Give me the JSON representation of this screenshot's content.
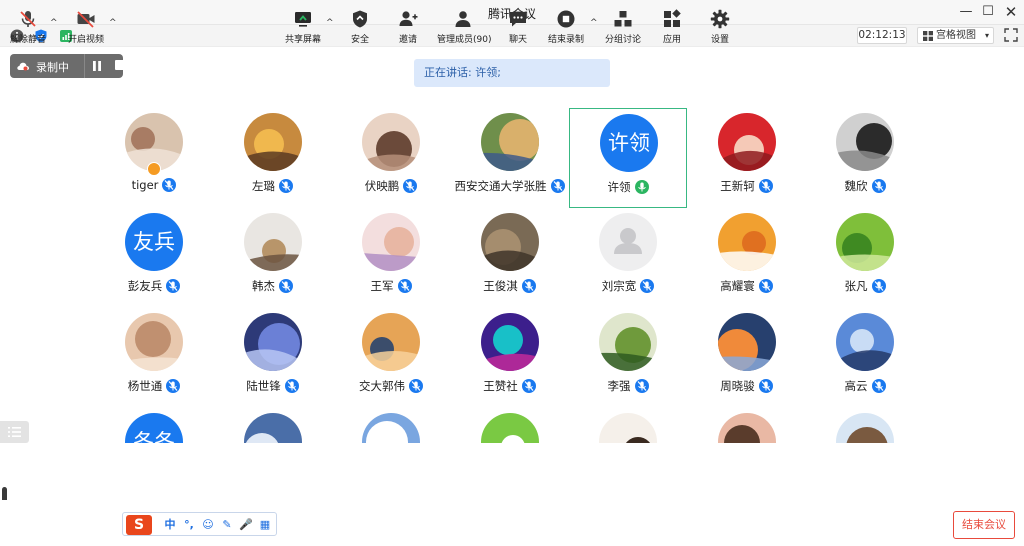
{
  "window": {
    "title": "腾讯会议",
    "controls": {
      "minimize": "—",
      "maximize": "☐",
      "close": "✕"
    }
  },
  "infobar": {
    "icons": [
      "info-icon",
      "shield-icon",
      "signal-icon"
    ],
    "timer": "02:12:13",
    "view_mode": "宫格视图",
    "view_caret": "▾"
  },
  "recording": {
    "label": "录制中",
    "icon": "cloud-record-icon"
  },
  "speaker": {
    "text": "正在讲话: 许领;"
  },
  "participants": [
    {
      "name": "tiger",
      "avatar": "photo",
      "host": true,
      "mic": "muted"
    },
    {
      "name": "左璐",
      "avatar": "photo",
      "mic": "muted"
    },
    {
      "name": "伏映鹏",
      "avatar": "photo",
      "mic": "muted"
    },
    {
      "name": "西安交通大学张胜",
      "avatar": "photo",
      "mic": "muted"
    },
    {
      "name": "许领",
      "avatar_text": "许领",
      "avatar": "text",
      "mic": "speaking",
      "active": true
    },
    {
      "name": "王新轲",
      "avatar": "photo",
      "mic": "muted"
    },
    {
      "name": "魏欣",
      "avatar": "photo",
      "mic": "muted"
    },
    {
      "name": "彭友兵",
      "avatar_text": "友兵",
      "avatar": "text",
      "mic": "muted"
    },
    {
      "name": "韩杰",
      "avatar": "photo",
      "mic": "muted"
    },
    {
      "name": "王军",
      "avatar": "photo",
      "mic": "muted"
    },
    {
      "name": "王俊淇",
      "avatar": "photo",
      "mic": "muted"
    },
    {
      "name": "刘宗宽",
      "avatar": "blank",
      "mic": "muted"
    },
    {
      "name": "高耀寰",
      "avatar": "photo",
      "mic": "muted"
    },
    {
      "name": "张凡",
      "avatar": "photo",
      "mic": "muted"
    },
    {
      "name": "杨世通",
      "avatar": "photo",
      "mic": "muted"
    },
    {
      "name": "陆世锋",
      "avatar": "photo",
      "mic": "muted"
    },
    {
      "name": "交大郭伟",
      "avatar": "photo",
      "mic": "muted"
    },
    {
      "name": "王赞社",
      "avatar": "photo",
      "mic": "muted"
    },
    {
      "name": "李强",
      "avatar": "photo",
      "mic": "muted"
    },
    {
      "name": "周晓骏",
      "avatar": "photo",
      "mic": "muted"
    },
    {
      "name": "高云",
      "avatar": "photo",
      "mic": "muted"
    },
    {
      "name": "",
      "avatar_text": "冬冬",
      "avatar": "text",
      "mic": "muted",
      "partial": true
    },
    {
      "name": "",
      "avatar": "photo",
      "partial": true
    },
    {
      "name": "",
      "avatar": "photo",
      "partial": true
    },
    {
      "name": "",
      "avatar": "photo",
      "partial": true
    },
    {
      "name": "",
      "avatar": "photo",
      "partial": true
    },
    {
      "name": "",
      "avatar": "photo",
      "partial": true
    },
    {
      "name": "",
      "avatar": "photo",
      "partial": true
    }
  ],
  "toolbar": {
    "unmute": "解除静音",
    "start_video": "开启视频",
    "share_screen": "共享屏幕",
    "security": "安全",
    "invite": "邀请",
    "manage_members": "管理成员(90)",
    "chat": "聊天",
    "end_recording": "结束录制",
    "breakout": "分组讨论",
    "apps": "应用",
    "settings": "设置",
    "end_meeting": "结束会议",
    "caret": "^"
  },
  "ime": {
    "logo": "S",
    "items": [
      "中",
      "°,",
      "☺",
      "✎",
      "🎤",
      "▦"
    ]
  },
  "colors": {
    "accent": "#1a79ef",
    "active_border": "#38b883",
    "end_button": "#e84a3c",
    "speaker_banner": "#dbe8fb"
  }
}
